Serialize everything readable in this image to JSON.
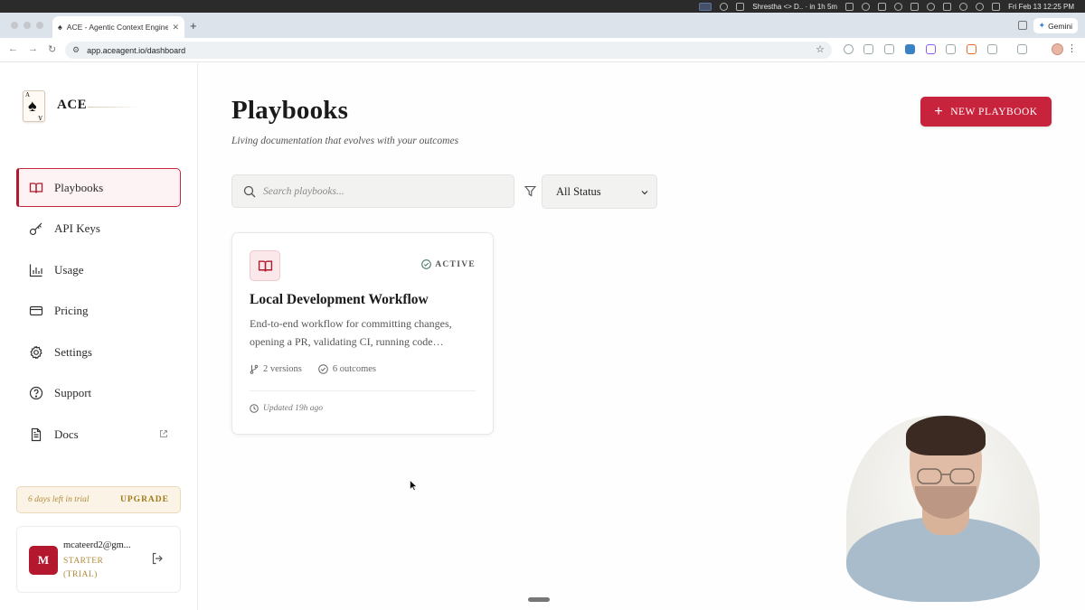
{
  "os": {
    "menubar": {
      "calendar_item": "Shrestha <> D.. · in 1h 5m",
      "datetime": "Fri Feb 13  12:25 PM"
    }
  },
  "browser": {
    "tab_title": "ACE - Agentic Context Engine",
    "url": "app.aceagent.io/dashboard",
    "gemini_label": "Gemini"
  },
  "sidebar": {
    "brand": "ACE",
    "items": [
      {
        "label": "Playbooks",
        "icon": "book-icon",
        "active": true
      },
      {
        "label": "API Keys",
        "icon": "key-icon"
      },
      {
        "label": "Usage",
        "icon": "bar-chart-icon"
      },
      {
        "label": "Pricing",
        "icon": "credit-card-icon"
      },
      {
        "label": "Settings",
        "icon": "gear-icon"
      },
      {
        "label": "Support",
        "icon": "help-circle-icon"
      },
      {
        "label": "Docs",
        "icon": "document-icon"
      }
    ],
    "trial": {
      "text": "6 days left in trial",
      "action": "UPGRADE"
    },
    "user": {
      "initial": "M",
      "email": "mcateerd2@gm...",
      "plan_line1": "STARTER",
      "plan_line2": "(TRIAL)"
    }
  },
  "main": {
    "title": "Playbooks",
    "subtitle": "Living documentation that evolves with your outcomes",
    "new_button": "NEW PLAYBOOK",
    "search_placeholder": "Search playbooks...",
    "status_filter": {
      "selected": "All Status"
    },
    "playbooks": [
      {
        "title": "Local Development Workflow",
        "status": "ACTIVE",
        "description_line1": "End-to-end workflow for committing changes,",
        "description_line2": "opening a PR, validating CI, running code…",
        "versions": "2 versions",
        "outcomes": "6 outcomes",
        "updated": "Updated 19h ago"
      }
    ]
  },
  "colors": {
    "accent": "#c8233c",
    "gold": "#b08a3a",
    "active_bg": "#fdf2f4"
  }
}
